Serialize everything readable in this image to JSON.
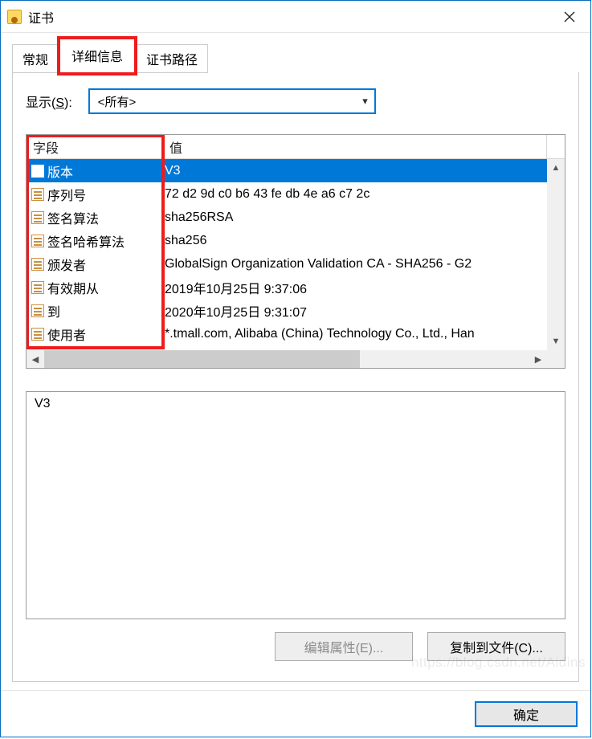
{
  "window": {
    "title": "证书",
    "close_aria": "Close"
  },
  "tabs": {
    "general": "常规",
    "details": "详细信息",
    "path": "证书路径"
  },
  "show": {
    "label_prefix": "显示(",
    "label_key": "S",
    "label_suffix": "):",
    "selected": "<所有>"
  },
  "table": {
    "header_field": "字段",
    "header_value": "值",
    "rows": [
      {
        "field": "版本",
        "value": "V3",
        "selected": true
      },
      {
        "field": "序列号",
        "value": "72 d2 9d c0 b6 43 fe db 4e a6 c7 2c",
        "selected": false
      },
      {
        "field": "签名算法",
        "value": "sha256RSA",
        "selected": false
      },
      {
        "field": "签名哈希算法",
        "value": "sha256",
        "selected": false
      },
      {
        "field": "颁发者",
        "value": "GlobalSign Organization Validation CA - SHA256 - G2",
        "selected": false
      },
      {
        "field": "有效期从",
        "value": "2019年10月25日 9:37:06",
        "selected": false
      },
      {
        "field": "到",
        "value": "2020年10月25日 9:31:07",
        "selected": false
      },
      {
        "field": "使用者",
        "value": "*.tmall.com, Alibaba (China) Technology Co., Ltd., Han",
        "selected": false
      }
    ]
  },
  "detail_value": "V3",
  "buttons": {
    "edit_props": "编辑属性(E)...",
    "copy_to_file": "复制到文件(C)...",
    "ok": "确定"
  },
  "watermark": "https://blog.csdn.net/Aidins"
}
